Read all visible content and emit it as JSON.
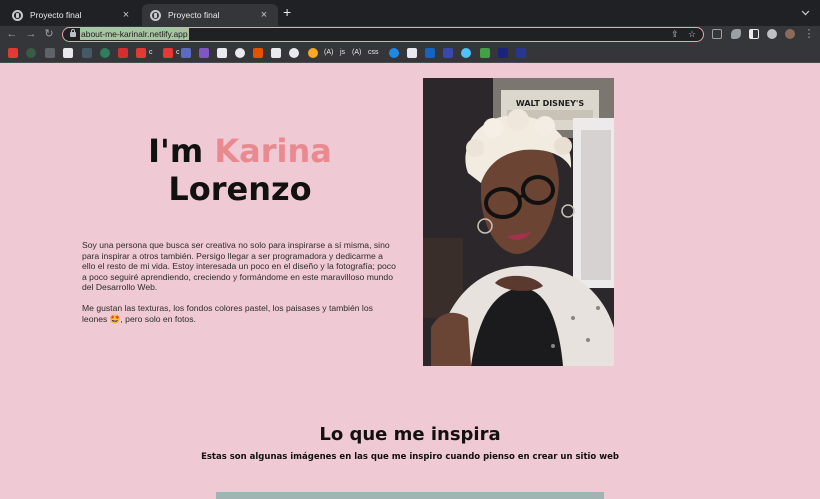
{
  "browser": {
    "tabs": [
      {
        "title": "Proyecto final",
        "active": false
      },
      {
        "title": "Proyecto final",
        "active": true
      }
    ],
    "new_tab": "+",
    "url": "about-me-karinalr.netlify.app",
    "bookmarks": {
      "c1": "c",
      "c2": "c",
      "js": "js",
      "css": "css",
      "acode1": "(A)",
      "acode2": "(A)"
    }
  },
  "hero": {
    "prefix": "I'm ",
    "first_name": "Karina",
    "last_name": "Lorenzo",
    "accent_color": "#e88a8f"
  },
  "bio": {
    "paragraph1": "Soy una persona que busca ser creativa no solo para inspirarse a sí misma, sino para inspirar a otros también. Persigo llegar a ser programadora y dedicarme a ello el resto de mi vida. Estoy interesada un poco en el diseño y la fotografía; poco a poco seguiré aprendiendo, creciendo y formándome en este maravilloso mundo del Desarrollo Web.",
    "paragraph2": "Me gustan las texturas, los fondos colores pastel, los paisases y también los leones 🤩, pero solo en fotos."
  },
  "portrait": {
    "poster_text": "WALT DISNEY'S"
  },
  "inspiration": {
    "title": "Lo que me inspira",
    "subtitle": "Estas son algunas imágenes en las que me inspiro cuando pienso en crear un sitio web"
  },
  "colors": {
    "page_background": "#efc9d3",
    "accent": "#e88a8f"
  }
}
